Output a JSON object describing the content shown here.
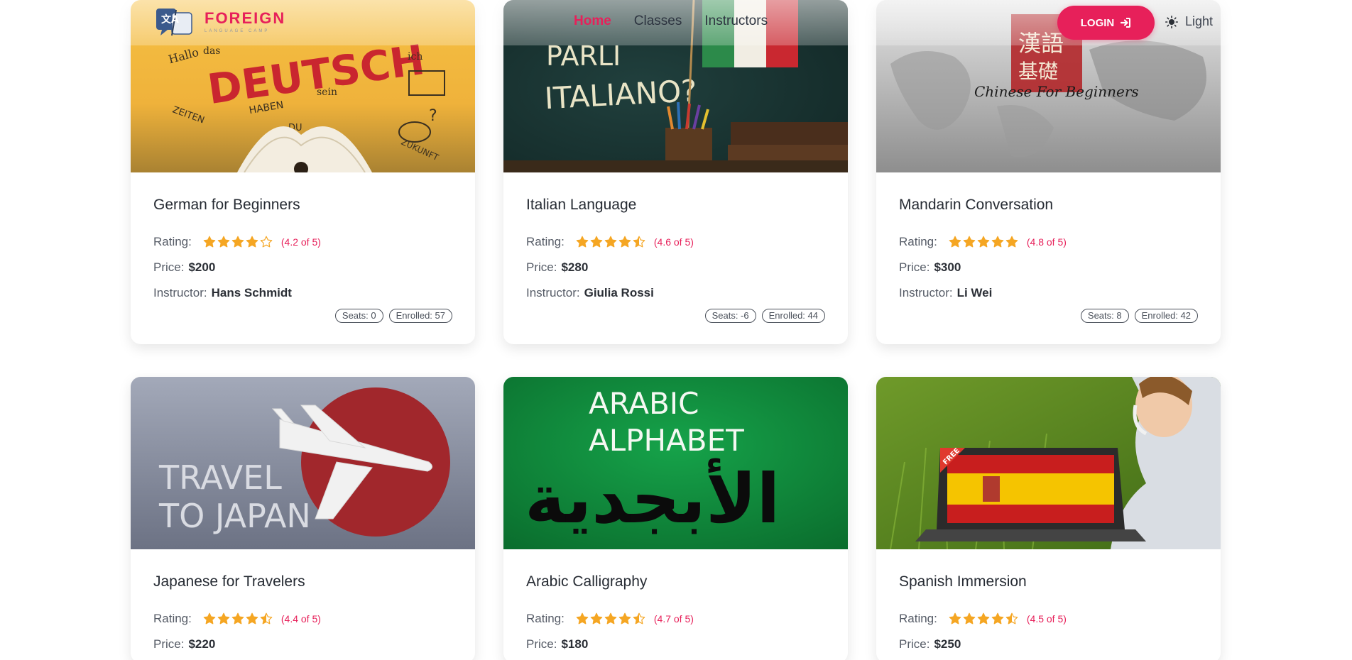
{
  "brand": {
    "name": "FOREIGN",
    "sub": "LANGUAGE CAMP",
    "logo_glyphs": "文A"
  },
  "nav": {
    "items": [
      {
        "label": "Home",
        "active": true
      },
      {
        "label": "Classes",
        "active": false
      },
      {
        "label": "Instructors",
        "active": false
      }
    ],
    "login_label": "LOGIN",
    "theme_label": "Light"
  },
  "labels": {
    "rating": "Rating:",
    "price": "Price:",
    "instructor": "Instructor:"
  },
  "colors": {
    "accent": "#e7205a",
    "star": "#f5a623"
  },
  "cards": [
    {
      "title": "German for Beginners",
      "rating": 4.2,
      "rating_text": "(4.2 of 5)",
      "price": "$200",
      "instructor": "Hans Schmidt",
      "seats": "Seats: 0",
      "enrolled": "Enrolled: 57",
      "image_text": [
        "DEUTSCH",
        "Hallo",
        "das",
        "ich",
        "HABEN",
        "sein",
        "ZEITEN",
        "DU",
        "ZUKUNFT"
      ]
    },
    {
      "title": "Italian Language",
      "rating": 4.6,
      "rating_text": "(4.6 of 5)",
      "price": "$280",
      "instructor": "Giulia Rossi",
      "seats": "Seats: -6",
      "enrolled": "Enrolled: 44",
      "image_text": [
        "PARLI",
        "ITALIANO?"
      ]
    },
    {
      "title": "Mandarin Conversation",
      "rating": 4.8,
      "rating_text": "(4.8 of 5)",
      "price": "$300",
      "instructor": "Li Wei",
      "seats": "Seats: 8",
      "enrolled": "Enrolled: 42",
      "image_text": [
        "漢語",
        "基礎",
        "Chinese For Beginners"
      ]
    },
    {
      "title": "Japanese for Travelers",
      "rating": 4.4,
      "rating_text": "(4.4 of 5)",
      "price": "$220",
      "instructor": "",
      "seats": "",
      "enrolled": "",
      "image_text": [
        "TRAVEL",
        "TO JAPAN"
      ]
    },
    {
      "title": "Arabic Calligraphy",
      "rating": 4.7,
      "rating_text": "(4.7 of 5)",
      "price": "$180",
      "instructor": "",
      "seats": "",
      "enrolled": "",
      "image_text": [
        "ARABIC",
        "ALPHABET",
        "الأبجدية"
      ]
    },
    {
      "title": "Spanish Immersion",
      "rating": 4.5,
      "rating_text": "(4.5 of 5)",
      "price": "$250",
      "instructor": "",
      "seats": "",
      "enrolled": "",
      "image_text": [
        "FREE"
      ]
    }
  ]
}
